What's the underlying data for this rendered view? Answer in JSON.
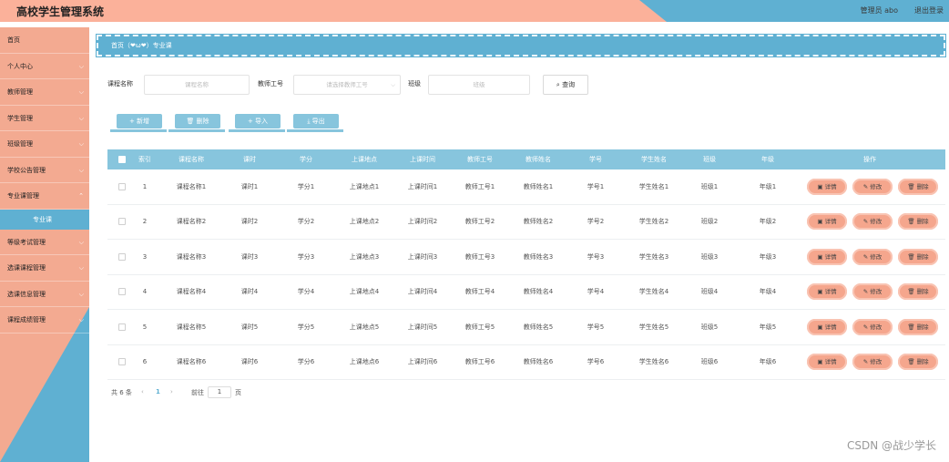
{
  "header": {
    "title": "高校学生管理系统",
    "admin_label": "管理员 abo",
    "logout_label": "退出登录"
  },
  "sidebar": {
    "items": [
      {
        "label": "首页",
        "has_chevron": false
      },
      {
        "label": "个人中心",
        "has_chevron": true
      },
      {
        "label": "教师管理",
        "has_chevron": true
      },
      {
        "label": "学生管理",
        "has_chevron": true
      },
      {
        "label": "班级管理",
        "has_chevron": true
      },
      {
        "label": "学校公告管理",
        "has_chevron": true
      },
      {
        "label": "专业课管理",
        "has_chevron": true,
        "expanded": true,
        "sub": "专业课"
      },
      {
        "label": "等级考试管理",
        "has_chevron": true
      },
      {
        "label": "选课课程管理",
        "has_chevron": true
      },
      {
        "label": "选课信息管理",
        "has_chevron": true
      },
      {
        "label": "课程成绩管理",
        "has_chevron": true
      }
    ]
  },
  "breadcrumb": "首页（❤ω❤）专业课",
  "search": {
    "course_label": "课程名称",
    "course_placeholder": "课程名称",
    "teacher_label": "教师工号",
    "teacher_placeholder": "请选择教师工号",
    "class_label": "班级",
    "class_placeholder": "班级",
    "query_label": "查询"
  },
  "actions": {
    "add": "+ 新增",
    "delete": "删除",
    "import": "+ 导入",
    "export": "导出"
  },
  "table": {
    "headers": [
      "索引",
      "课程名称",
      "课时",
      "学分",
      "上课地点",
      "上课时间",
      "教师工号",
      "教师姓名",
      "学号",
      "学生姓名",
      "班级",
      "年级",
      "操作"
    ],
    "rows": [
      [
        "1",
        "课程名称1",
        "课时1",
        "学分1",
        "上课地点1",
        "上课时间1",
        "教师工号1",
        "教师姓名1",
        "学号1",
        "学生姓名1",
        "班级1",
        "年级1"
      ],
      [
        "2",
        "课程名称2",
        "课时2",
        "学分2",
        "上课地点2",
        "上课时间2",
        "教师工号2",
        "教师姓名2",
        "学号2",
        "学生姓名2",
        "班级2",
        "年级2"
      ],
      [
        "3",
        "课程名称3",
        "课时3",
        "学分3",
        "上课地点3",
        "上课时间3",
        "教师工号3",
        "教师姓名3",
        "学号3",
        "学生姓名3",
        "班级3",
        "年级3"
      ],
      [
        "4",
        "课程名称4",
        "课时4",
        "学分4",
        "上课地点4",
        "上课时间4",
        "教师工号4",
        "教师姓名4",
        "学号4",
        "学生姓名4",
        "班级4",
        "年级4"
      ],
      [
        "5",
        "课程名称5",
        "课时5",
        "学分5",
        "上课地点5",
        "上课时间5",
        "教师工号5",
        "教师姓名5",
        "学号5",
        "学生姓名5",
        "班级5",
        "年级5"
      ],
      [
        "6",
        "课程名称6",
        "课时6",
        "学分6",
        "上课地点6",
        "上课时间6",
        "教师工号6",
        "教师姓名6",
        "学号6",
        "学生姓名6",
        "班级6",
        "年级6"
      ]
    ],
    "op_labels": {
      "detail": "详情",
      "edit": "修改",
      "delete": "删除"
    }
  },
  "pagination": {
    "total": "共 6 条",
    "current_page": "1",
    "goto_label": "前往",
    "goto_value": "1",
    "page_suffix": "页"
  },
  "watermark": "CSDN @战少学长",
  "colors": {
    "salmon": "#f3aa91",
    "blue": "#5fb0d2",
    "light_blue": "#87c5dd"
  }
}
